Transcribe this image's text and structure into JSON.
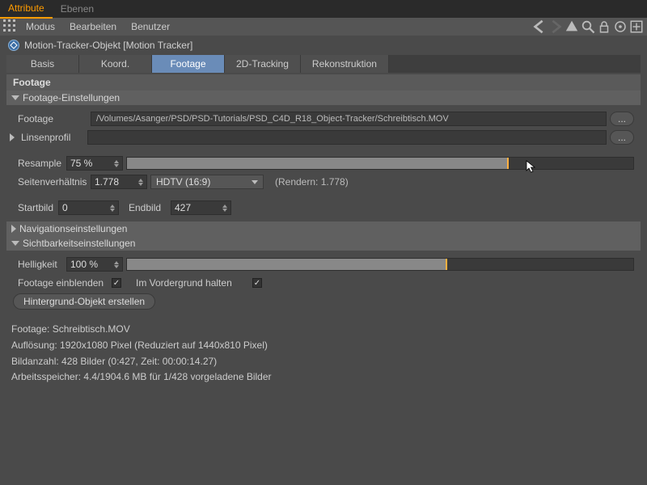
{
  "tabs": {
    "attribute": "Attribute",
    "ebenen": "Ebenen"
  },
  "toolbar": {
    "menus": {
      "modus": "Modus",
      "bearbeiten": "Bearbeiten",
      "benutzer": "Benutzer"
    }
  },
  "object": {
    "title": "Motion-Tracker-Objekt [Motion Tracker]"
  },
  "subtabs": {
    "basis": "Basis",
    "koord": "Koord.",
    "footage": "Footage",
    "tracking": "2D-Tracking",
    "rekon": "Rekonstruktion"
  },
  "sectionTitle": "Footage",
  "groups": {
    "einst": "Footage-Einstellungen",
    "nav": "Navigationseinstellungen",
    "sicht": "Sichtbarkeitseinstellungen"
  },
  "labels": {
    "footage": "Footage",
    "linsenprofil": "Linsenprofil",
    "resample": "Resample",
    "seiten": "Seitenverhältnis",
    "startbild": "Startbild",
    "endbild": "Endbild",
    "helligkeit": "Helligkeit",
    "fEinblenden": "Footage einblenden",
    "imVorder": "Im Vordergrund halten"
  },
  "values": {
    "path": "/Volumes/Asanger/PSD/PSD-Tutorials/PSD_C4D_R18_Object-Tracker/Schreibtisch.MOV",
    "linsenprofil": "",
    "resample": "75 %",
    "resamplePct": 75,
    "seiten": "1.778",
    "seitenPreset": "HDTV (16:9)",
    "renderText": "(Rendern: 1.778)",
    "startbild": "0",
    "endbild": "427",
    "helligkeit": "100 %",
    "helligkeitPct": 63,
    "fEinblenden": true,
    "imVorder": true
  },
  "buttons": {
    "ell": "...",
    "hintergrund": "Hintergrund-Objekt erstellen"
  },
  "info": {
    "l1": "Footage: Schreibtisch.MOV",
    "l2": "Auflösung: 1920x1080 Pixel (Reduziert auf 1440x810 Pixel)",
    "l3": "Bildanzahl: 428 Bilder (0:427, Zeit: 00:00:14.27)",
    "l4": "Arbeitsspeicher: 4.4/1904.6 MB für 1/428 vorgeladene Bilder"
  }
}
